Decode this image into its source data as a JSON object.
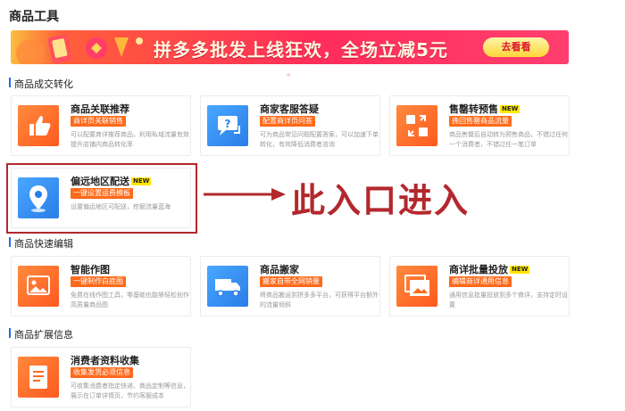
{
  "page": {
    "title": "商品工具"
  },
  "banner": {
    "text": "拼多多批发上线狂欢，全场立减5元",
    "button_label": "去看看"
  },
  "sections": [
    {
      "title": "商品成交转化",
      "cards": [
        {
          "title": "商品关联推荐",
          "new": "",
          "tag": "商详页关联销售",
          "desc": "可以配置商详推荐商品，利用私域流量有效提升店铺内商品转化率",
          "icon": "thumbs-up-icon"
        },
        {
          "title": "商家客服答疑",
          "new": "",
          "tag": "配置商详页问答",
          "desc": "可为商品常见问题配置答案，可以加速下单转化，有效降低消费者咨询",
          "icon": "chat-question-icon"
        },
        {
          "title": "售罄转预售",
          "new": "NEW",
          "tag": "挽回售罄商品流量",
          "desc": "商品售罄后自动转为预售商品，不错过任何一个消费者，不错过任一笔订单",
          "icon": "swap-icon"
        }
      ]
    },
    {
      "title": "",
      "cards": [
        {
          "title": "偏远地区配送",
          "new": "NEW",
          "tag": "一键设置运费模板",
          "desc": "设置偏远地区可配送，挖掘流量蓝海",
          "icon": "location-pin-icon"
        }
      ]
    },
    {
      "title": "商品快速编辑",
      "cards": [
        {
          "title": "智能作图",
          "new": "",
          "tag": "一键制作白底图",
          "desc": "免费在线作图工具，零基础也能够轻松创作高质量商品图",
          "icon": "image-icon"
        },
        {
          "title": "商品搬家",
          "new": "",
          "tag": "搬家自带全网销量",
          "desc": "将商品搬运到拼多多平台，可获得平台额外的流量倾斜",
          "icon": "truck-icon"
        },
        {
          "title": "商详批量投放",
          "new": "NEW",
          "tag": "编辑商详通用信息",
          "desc": "通用信息批量投放到多个商详，支持定时设置",
          "icon": "gallery-icon"
        }
      ]
    },
    {
      "title": "商品扩展信息",
      "cards": [
        {
          "title": "消费者资料收集",
          "new": "",
          "tag": "收集发货必须信息",
          "desc": "可收集消费者指定快递、商品定制等信息，展示在订单详情页，节约客服成本",
          "icon": "document-icon"
        }
      ]
    }
  ],
  "annotation": {
    "text": "此入口进入"
  },
  "colors": {
    "accent": "#ff6a1a",
    "highlight": "#b3282d",
    "section_bar": "#1f6fe5"
  }
}
